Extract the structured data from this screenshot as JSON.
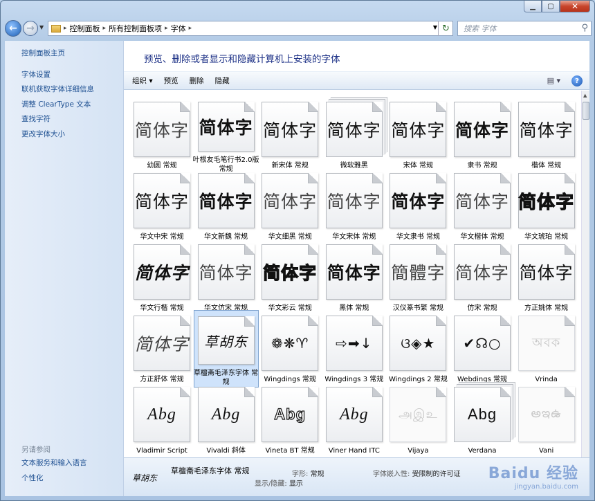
{
  "window": {
    "controls": {
      "minimize": "▁",
      "maximize": "▢",
      "close": "✕"
    }
  },
  "nav": {
    "breadcrumb": [
      "控制面板",
      "所有控制面板项",
      "字体"
    ],
    "search_placeholder": "搜索 字体"
  },
  "sidebar": {
    "home": "控制面板主页",
    "tasks": [
      "字体设置",
      "联机获取字体详细信息",
      "调整 ClearType 文本",
      "查找字符",
      "更改字体大小"
    ],
    "see_also": "另请参阅",
    "see_also_links": [
      "文本服务和输入语言",
      "个性化"
    ]
  },
  "heading": "预览、删除或者显示和隐藏计算机上安装的字体",
  "toolbar": {
    "organize": "组织 ▾",
    "preview": "预览",
    "delete": "删除",
    "hide": "隐藏"
  },
  "fonts": [
    {
      "glyph": "简体字",
      "label": "幼圆 常规",
      "style": "g-light"
    },
    {
      "glyph": "简体字",
      "label": "叶根友毛笔行书2.0版 常规",
      "style": "g-bold"
    },
    {
      "glyph": "简体字",
      "label": "新宋体 常规",
      "style": "g-serif"
    },
    {
      "glyph": "简体字",
      "label": "微软雅黑",
      "style": "",
      "stack": true
    },
    {
      "glyph": "简体字",
      "label": "宋体 常规",
      "style": "g-serif"
    },
    {
      "glyph": "简体字",
      "label": "隶书 常规",
      "style": "g-bold g-serif"
    },
    {
      "glyph": "简体字",
      "label": "楷体 常规",
      "style": "g-serif"
    },
    {
      "glyph": "简体字",
      "label": "华文中宋 常规",
      "style": "g-serif"
    },
    {
      "glyph": "简体字",
      "label": "华文新魏 常规",
      "style": "g-bold"
    },
    {
      "glyph": "简体字",
      "label": "华文细黑 常规",
      "style": "g-light"
    },
    {
      "glyph": "简体字",
      "label": "华文宋体 常规",
      "style": "g-serif g-light"
    },
    {
      "glyph": "简体字",
      "label": "华文隶书 常规",
      "style": "g-bold g-serif"
    },
    {
      "glyph": "简体字",
      "label": "华文楷体 常规",
      "style": "g-serif g-light"
    },
    {
      "glyph": "简体字",
      "label": "华文琥珀 常规",
      "style": "g-heavy"
    },
    {
      "glyph": "简体字",
      "label": "华文行楷 常规",
      "style": "g-bold g-ital"
    },
    {
      "glyph": "简体字",
      "label": "华文仿宋 常规",
      "style": "g-serif g-light"
    },
    {
      "glyph": "简体字",
      "label": "华文彩云 常规",
      "style": "g-outline"
    },
    {
      "glyph": "简体字",
      "label": "黑体 常规",
      "style": "g-bold"
    },
    {
      "glyph": "簡體字",
      "label": "汉仪篆书繁 常规",
      "style": "g-serif g-light"
    },
    {
      "glyph": "简体字",
      "label": "仿宋 常规",
      "style": "g-serif g-light"
    },
    {
      "glyph": "简体字",
      "label": "方正姚体 常规",
      "style": "g-serif"
    },
    {
      "glyph": "简体字",
      "label": "方正舒体 常规",
      "style": "g-ital g-light"
    },
    {
      "glyph": "草胡东",
      "label": "草檀斋毛泽东字体 常规",
      "style": "g-ital g-small",
      "selected": true
    },
    {
      "glyph": "❁❋♈",
      "label": "Wingdings 常规",
      "style": "g-small"
    },
    {
      "glyph": "⇨➡↓",
      "label": "Wingdings 3 常规",
      "style": "g-small"
    },
    {
      "glyph": "ଓ◈★",
      "label": "Wingdings 2 常规",
      "style": "g-small"
    },
    {
      "glyph": "✔☊○",
      "label": "Webdings 常规",
      "style": "g-small"
    },
    {
      "glyph": "অবক",
      "label": "Vrinda",
      "style": "g-faint",
      "ghost": true
    },
    {
      "glyph": "Abg",
      "label": "Vladimir Script",
      "style": "g-latin"
    },
    {
      "glyph": "Abg",
      "label": "Vivaldi 斜体",
      "style": "g-latin"
    },
    {
      "glyph": "Abg",
      "label": "Vineta BT 常规",
      "style": "g-outline g-sans"
    },
    {
      "glyph": "Abg",
      "label": "Viner Hand ITC",
      "style": "g-latin"
    },
    {
      "glyph": "அஇஉ",
      "label": "Vijaya",
      "style": "g-faint",
      "ghost": true
    },
    {
      "glyph": "Abg",
      "label": "Verdana",
      "style": "g-sans",
      "stack": true
    },
    {
      "glyph": "అఇఉ",
      "label": "Vani",
      "style": "g-faint",
      "ghost": true
    }
  ],
  "details": {
    "thumb": "草胡东",
    "name": "草檀斋毛泽东字体 常规",
    "style_label": "字形:",
    "style_value": "常规",
    "show_label": "显示/隐藏:",
    "show_value": "显示",
    "embed_label": "字体嵌入性:",
    "embed_value": "受限制的许可证"
  },
  "watermark": {
    "big": "Baidu 经验",
    "small": "jingyan.baidu.com"
  }
}
